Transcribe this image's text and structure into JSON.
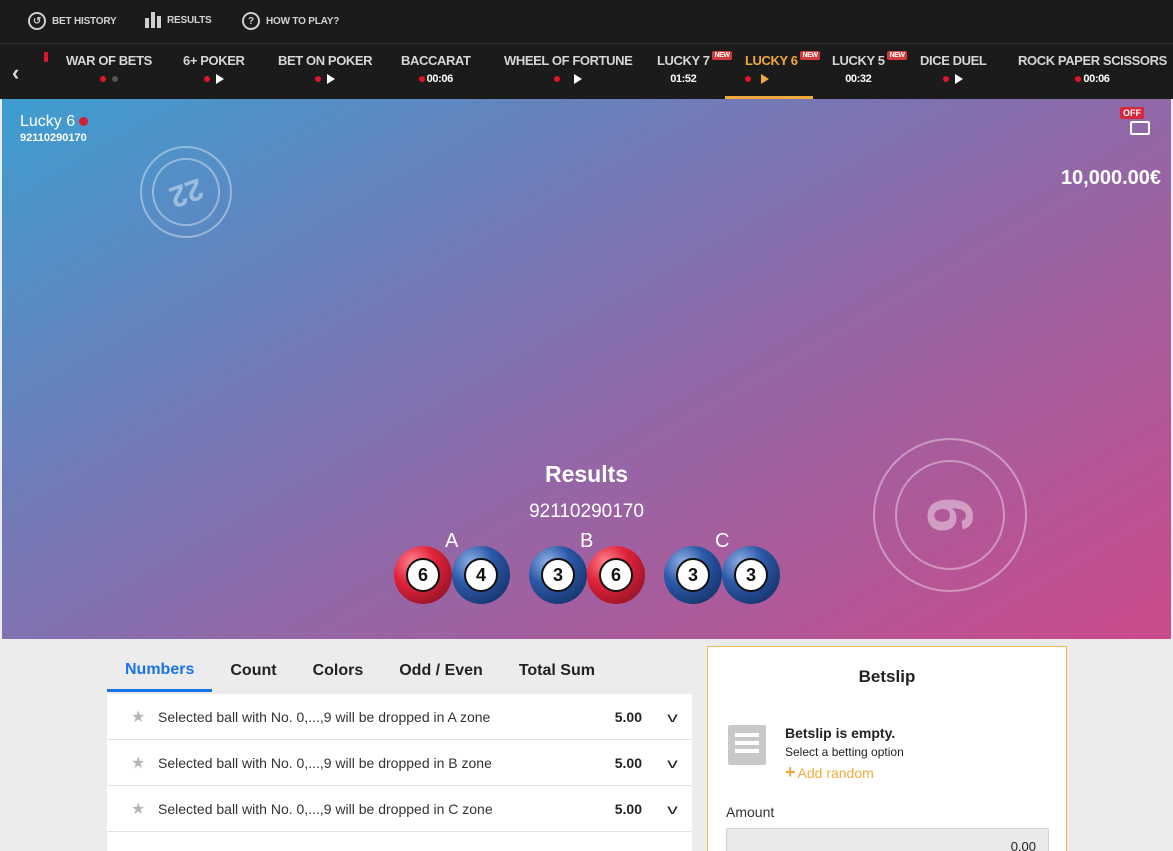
{
  "top_nav": {
    "bet_history": "BET HISTORY",
    "results": "RESULTS",
    "how_to_play": "HOW TO PLAY?"
  },
  "games": [
    {
      "name": "WAR OF BETS",
      "status": "",
      "type": "dot-dim"
    },
    {
      "name": "6+ POKER",
      "status": "",
      "type": "play"
    },
    {
      "name": "BET ON POKER",
      "status": "",
      "type": "play"
    },
    {
      "name": "BACCARAT",
      "status": "00:06",
      "type": "timer"
    },
    {
      "name": "WHEEL OF FORTUNE",
      "status": "",
      "type": "play"
    },
    {
      "name": "LUCKY 7",
      "status": "01:52",
      "type": "timer-new",
      "badge": "NEW"
    },
    {
      "name": "LUCKY 6",
      "status": "",
      "type": "play-active",
      "badge": "NEW"
    },
    {
      "name": "LUCKY 5",
      "status": "00:32",
      "type": "timer-new",
      "badge": "NEW"
    },
    {
      "name": "DICE DUEL",
      "status": "",
      "type": "play"
    },
    {
      "name": "ROCK PAPER SCISSORS",
      "status": "00:06",
      "type": "timer"
    }
  ],
  "stage": {
    "game_title": "Lucky 6",
    "round_id": "92110290170",
    "off_label": "OFF",
    "balance": "10,000.00€",
    "deco_left": "22",
    "deco_right": "6"
  },
  "results": {
    "title": "Results",
    "round_id": "92110290170",
    "zones": [
      {
        "label": "A",
        "balls": [
          {
            "n": "6",
            "color": "red"
          },
          {
            "n": "4",
            "color": "blue"
          }
        ]
      },
      {
        "label": "B",
        "balls": [
          {
            "n": "3",
            "color": "blue"
          },
          {
            "n": "6",
            "color": "red"
          }
        ]
      },
      {
        "label": "C",
        "balls": [
          {
            "n": "3",
            "color": "blue"
          },
          {
            "n": "3",
            "color": "blue"
          }
        ]
      }
    ]
  },
  "bet_tabs": [
    "Numbers",
    "Count",
    "Colors",
    "Odd / Even",
    "Total Sum"
  ],
  "bets": [
    {
      "desc": "Selected ball with No. 0,...,9 will be dropped in A zone",
      "odd": "5.00"
    },
    {
      "desc": "Selected ball with No. 0,...,9 will be dropped in B zone",
      "odd": "5.00"
    },
    {
      "desc": "Selected ball with No. 0,...,9 will be dropped in C zone",
      "odd": "5.00"
    }
  ],
  "betslip": {
    "title": "Betslip",
    "empty": "Betslip is empty.",
    "select": "Select a betting option",
    "add_random": "Add random",
    "amount_label": "Amount",
    "amount_value": "0.00"
  },
  "colors": {
    "accent": "#f2a93b",
    "tab_active": "#1a73e8",
    "live_dot": "#e0142a"
  }
}
